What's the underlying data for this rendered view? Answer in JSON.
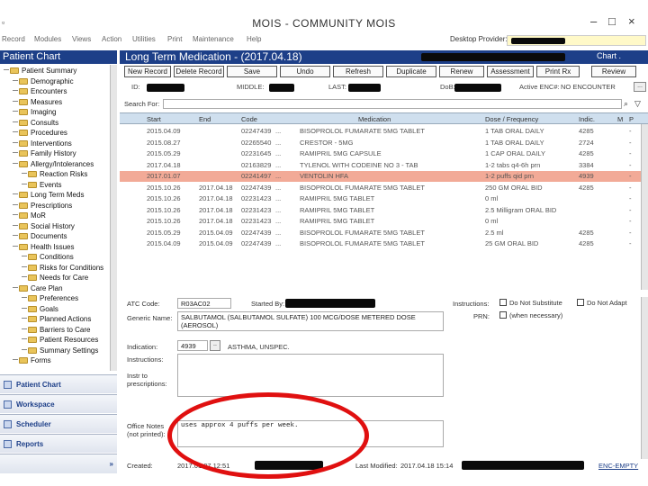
{
  "window": {
    "title": "MOIS - COMMUNITY MOIS",
    "minimize": "–",
    "maximize": "□",
    "close": "×"
  },
  "menu": {
    "items": [
      "Record",
      "Modules",
      "Views",
      "Action",
      "Utilities",
      "Print",
      "Maintenance",
      "Help"
    ],
    "desktop_provider_label": "Desktop Provider:"
  },
  "panel_left": {
    "title": "Patient Chart"
  },
  "panel_main": {
    "title": "Long Term Medication - (2017.04.18)",
    "chart_label": "Chart ."
  },
  "toolbar": {
    "buttons": [
      "New Record",
      "Delete Record",
      "Save",
      "Undo",
      "Refresh",
      "Duplicate",
      "Renew",
      "Assessment",
      "Print Rx",
      "Review"
    ]
  },
  "patient": {
    "id_label": "ID:",
    "middle_label": "MIDDLE:",
    "last_label": "LAST:",
    "dob_label": "DoB:",
    "active_enc_label": "Active ENC#:",
    "active_enc_value": "NO ENCOUNTER"
  },
  "search": {
    "label": "Search For:",
    "button": "..."
  },
  "grid": {
    "headers": [
      "Start",
      "End",
      "Code",
      "Medication",
      "Dose / Frequency",
      "Indic.",
      "M",
      "P"
    ],
    "rows": [
      {
        "start": "2015.04.09",
        "end": "",
        "code": "02247439",
        "med": "BISOPROLOL FUMARATE 5MG TABLET",
        "dose": "1 TAB ORAL DAILY",
        "indic": "4285",
        "m": "",
        "p": "-"
      },
      {
        "start": "2015.08.27",
        "end": "",
        "code": "02265540",
        "med": "CRESTOR - 5MG",
        "dose": "1 TAB ORAL DAILY",
        "indic": "2724",
        "m": "",
        "p": "-"
      },
      {
        "start": "2015.05.29",
        "end": "",
        "code": "02231645",
        "med": "RAMIPRIL 5MG CAPSULE",
        "dose": "1 CAP ORAL DAILY",
        "indic": "4285",
        "m": "",
        "p": "-"
      },
      {
        "start": "2017.04.18",
        "end": "",
        "code": "02163829",
        "med": "TYLENOL WITH CODEINE NO 3 - TAB",
        "dose": "1-2 tabs q4-6h prn",
        "indic": "3384",
        "m": "",
        "p": "-"
      },
      {
        "start": "2017.01.07",
        "end": "",
        "code": "02241497",
        "med": "VENTOLIN HFA",
        "dose": "1-2 puffs qid prn",
        "indic": "4939",
        "m": "",
        "p": "-"
      },
      {
        "start": "2015.10.26",
        "end": "2017.04.18",
        "code": "02247439",
        "med": "BISOPROLOL FUMARATE 5MG TABLET",
        "dose": "250 GM ORAL BID",
        "indic": "4285",
        "m": "",
        "p": "-"
      },
      {
        "start": "2015.10.26",
        "end": "2017.04.18",
        "code": "02231423",
        "med": "RAMIPRIL 5MG TABLET",
        "dose": "0 ml",
        "indic": "",
        "m": "",
        "p": "-"
      },
      {
        "start": "2015.10.26",
        "end": "2017.04.18",
        "code": "02231423",
        "med": "RAMIPRIL 5MG TABLET",
        "dose": "2.5 Milligram ORAL BID",
        "indic": "",
        "m": "",
        "p": "-"
      },
      {
        "start": "2015.10.26",
        "end": "2017.04.18",
        "code": "02231423",
        "med": "RAMIPRIL 5MG TABLET",
        "dose": "0 ml",
        "indic": "",
        "m": "",
        "p": "-"
      },
      {
        "start": "2015.05.29",
        "end": "2015.04.09",
        "code": "02247439",
        "med": "BISOPROLOL FUMARATE 5MG TABLET",
        "dose": "2.5 ml",
        "indic": "4285",
        "m": "",
        "p": "-"
      },
      {
        "start": "2015.04.09",
        "end": "2015.04.09",
        "code": "02247439",
        "med": "BISOPROLOL FUMARATE 5MG TABLET",
        "dose": "25 GM ORAL BID",
        "indic": "4285",
        "m": "",
        "p": "-"
      }
    ],
    "selected_row_color": "#f2aa97",
    "header_color": "#cfdfee"
  },
  "sidebar": {
    "tree": [
      {
        "label": "Patient Summary",
        "indent": 0
      },
      {
        "label": "Demographic",
        "indent": 1
      },
      {
        "label": "Encounters",
        "indent": 1
      },
      {
        "label": "Measures",
        "indent": 1
      },
      {
        "label": "Imaging",
        "indent": 1
      },
      {
        "label": "Consults",
        "indent": 1
      },
      {
        "label": "Procedures",
        "indent": 1
      },
      {
        "label": "Interventions",
        "indent": 1
      },
      {
        "label": "Family History",
        "indent": 1
      },
      {
        "label": "Allergy/Intolerances",
        "indent": 1
      },
      {
        "label": "Reaction Risks",
        "indent": 2
      },
      {
        "label": "Events",
        "indent": 2
      },
      {
        "label": "Long Term Meds",
        "indent": 1
      },
      {
        "label": "Prescriptions",
        "indent": 1
      },
      {
        "label": "MoR",
        "indent": 1
      },
      {
        "label": "Social History",
        "indent": 1
      },
      {
        "label": "Documents",
        "indent": 1
      },
      {
        "label": "Health Issues",
        "indent": 1
      },
      {
        "label": "Conditions",
        "indent": 2
      },
      {
        "label": "Risks for Conditions",
        "indent": 2
      },
      {
        "label": "Needs for Care",
        "indent": 2
      },
      {
        "label": "Care Plan",
        "indent": 1
      },
      {
        "label": "Preferences",
        "indent": 2
      },
      {
        "label": "Goals",
        "indent": 2
      },
      {
        "label": "Planned Actions",
        "indent": 2
      },
      {
        "label": "Barriers to Care",
        "indent": 2
      },
      {
        "label": "Patient Resources",
        "indent": 2
      },
      {
        "label": "Summary Settings",
        "indent": 2
      },
      {
        "label": "Forms",
        "indent": 1
      }
    ],
    "nav": [
      "Patient Chart",
      "Workspace",
      "Scheduler",
      "Reports"
    ]
  },
  "detail": {
    "atc_label": "ATC Code:",
    "atc_value": "R03AC02",
    "started_by_label": "Started By:",
    "generic_label": "Generic Name:",
    "generic_value": "SALBUTAMOL (SALBUTAMOL SULFATE) 100 MCG/DOSE METERED DOSE (AEROSOL)",
    "indication_label": "Indication:",
    "indication_code": "4939",
    "indication_text": "ASTHMA, UNSPEC.",
    "instructions_label": "Instructions:",
    "pp_label": "Instr to prescriptions:",
    "notes_label": "Office Notes (not printed):",
    "notes_value": "uses approx 4 puffs per week.",
    "instructions_right_label": "Instructions:",
    "do_not_substitute": "Do Not Substitute",
    "do_not_adapt": "Do Not Adapt",
    "prn_label": "PRN:",
    "prn_value": "(when necessary)",
    "created_label": "Created:",
    "created_value": "2017.01.07 12:51",
    "last_modified_label": "Last Modified:",
    "last_modified_value": "2017.04.18 15:14",
    "status_label": "ENC-EMPTY"
  },
  "annotation": {
    "color": "#e01010"
  }
}
